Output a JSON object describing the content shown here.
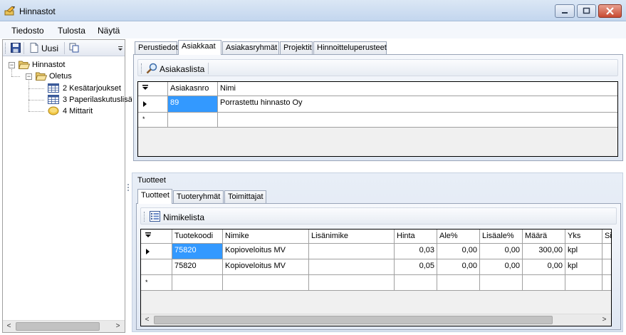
{
  "window": {
    "title": "Hinnastot",
    "icon": "pencil-app-icon",
    "controls": [
      "minimize-icon",
      "maximize-icon",
      "close-icon"
    ]
  },
  "menu": {
    "items": [
      "Tiedosto",
      "Tulosta",
      "Näytä"
    ]
  },
  "left_toolbar": {
    "new_label": "Uusi"
  },
  "tree": {
    "root": "Hinnastot",
    "child": "Oletus",
    "items": [
      "2 Kesätarjoukset",
      "3 Paperilaskutuslisä",
      "4 Mittarit"
    ]
  },
  "top_tabs": {
    "tabs": [
      "Perustiedot",
      "Asiakkaat",
      "Asiakasryhmät",
      "Projektit",
      "Hinnoitteluperusteet"
    ],
    "active": "Asiakkaat"
  },
  "customer_toolbar": {
    "label": "Asiakaslista"
  },
  "customer_grid": {
    "columns": [
      "Asiakasnro",
      "Nimi"
    ],
    "rows": [
      {
        "asiakasnro": "89",
        "nimi": "Porrastettu hinnasto Oy"
      }
    ],
    "new_row_marker": "*"
  },
  "products_group": {
    "title": "Tuotteet",
    "tabs": [
      "Tuotteet",
      "Tuoteryhmät",
      "Toimittajat"
    ],
    "active": "Tuotteet"
  },
  "product_toolbar": {
    "label": "Nimikelista"
  },
  "product_grid": {
    "columns": [
      "Tuotekoodi",
      "Nimike",
      "Lisänimike",
      "Hinta",
      "Ale%",
      "Lisäale%",
      "Määrä",
      "Yks",
      "Si"
    ],
    "rows": [
      {
        "tuotekoodi": "75820",
        "nimike": "Kopioveloitus MV",
        "lisanimike": "",
        "hinta": "0,03",
        "ale": "0,00",
        "lisaale": "0,00",
        "maara": "300,00",
        "yks": "kpl"
      },
      {
        "tuotekoodi": "75820",
        "nimike": "Kopioveloitus MV",
        "lisanimike": "",
        "hinta": "0,05",
        "ale": "0,00",
        "lisaale": "0,00",
        "maara": "0,00",
        "yks": "kpl"
      }
    ],
    "new_row_marker": "*"
  },
  "colors": {
    "selection": "#3399ff",
    "titlebar": "#c3d6ee",
    "close_button": "#c84a32"
  }
}
